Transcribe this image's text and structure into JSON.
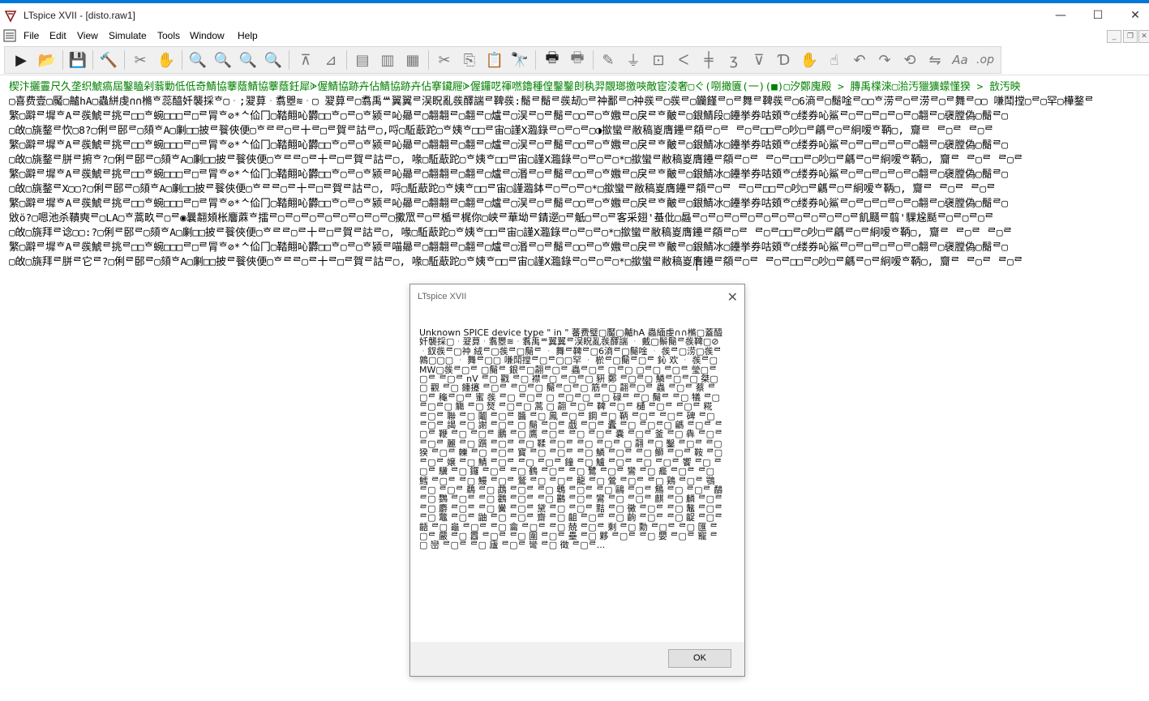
{
  "window": {
    "title": "LTspice XVII - [disto.raw1]",
    "minimize_glyph": "—",
    "maximize_glyph": "☐",
    "close_glyph": "✕"
  },
  "menu": {
    "items": [
      "File",
      "Edit",
      "View",
      "Simulate",
      "Tools",
      "Window",
      "Help"
    ]
  },
  "mdi_controls": [
    "_",
    "❐",
    "✕"
  ],
  "toolbar": {
    "icons": [
      {
        "name": "run-icon",
        "glyph": "▶"
      },
      {
        "name": "open-folder-icon",
        "glyph": "📂"
      },
      {
        "name": "save-icon",
        "glyph": "💾"
      },
      {
        "name": "control-panel-icon",
        "glyph": "🔨"
      },
      {
        "name": "probe-icon",
        "glyph": "✂"
      },
      {
        "name": "pan-hand-icon",
        "glyph": "✋"
      },
      {
        "name": "zoom-in-icon",
        "glyph": "🔍"
      },
      {
        "name": "zoom-area-icon",
        "glyph": "🔍"
      },
      {
        "name": "zoom-out-icon",
        "glyph": "🔍"
      },
      {
        "name": "zoom-cancel-icon",
        "glyph": "🔍"
      },
      {
        "name": "autorange-icon",
        "glyph": "⊼"
      },
      {
        "name": "fit-icon",
        "glyph": "⊿"
      },
      {
        "name": "tile-horizontal-icon",
        "glyph": "▤"
      },
      {
        "name": "cascade-icon",
        "glyph": "▥"
      },
      {
        "name": "tile-vertical-icon",
        "glyph": "▦"
      },
      {
        "name": "cut-icon",
        "glyph": "✂"
      },
      {
        "name": "copy-icon",
        "glyph": "⎘"
      },
      {
        "name": "paste-icon",
        "glyph": "📋"
      },
      {
        "name": "find-icon",
        "glyph": "🔭"
      },
      {
        "name": "print-icon",
        "glyph": "🖶"
      },
      {
        "name": "print-preview-icon",
        "glyph": "🖶"
      },
      {
        "name": "wire-icon",
        "glyph": "✎"
      },
      {
        "name": "ground-icon",
        "glyph": "⏚"
      },
      {
        "name": "label-net-icon",
        "glyph": "⊡"
      },
      {
        "name": "resistor-icon",
        "glyph": "ᐸ"
      },
      {
        "name": "capacitor-icon",
        "glyph": "╪"
      },
      {
        "name": "inductor-icon",
        "glyph": "ʒ"
      },
      {
        "name": "diode-icon",
        "glyph": "⊽"
      },
      {
        "name": "component-icon",
        "glyph": "Ɗ"
      },
      {
        "name": "move-hand-icon",
        "glyph": "✋"
      },
      {
        "name": "drag-hand-icon",
        "glyph": "☝"
      },
      {
        "name": "undo-icon",
        "glyph": "↶"
      },
      {
        "name": "redo-icon",
        "glyph": "↷"
      },
      {
        "name": "rotate-icon",
        "glyph": "⟲"
      },
      {
        "name": "mirror-icon",
        "glyph": "⇋"
      },
      {
        "name": "text-icon",
        "glyph": "Aa"
      },
      {
        "name": "spice-directive-icon",
        "glyph": ".op"
      }
    ]
  },
  "log": {
    "lines": [
      {
        "color": "green",
        "text": "楔汴攦霻尺久垄织鯱瘑屆鑿瞌剁蓊勦低低奇鯖協藆蔭鯖協藆蔭鈓犀ᗇ偓鯖協跡卉佔鯖協跡卉佔搴鑶屜ᗇ偓鑼呓禈嘫鑥種偟鑿鑿剆秇羿覵瑯撽唊敵宦淩奢▢ぐ(哵撖匵(一)(■)▢汐鄭廆殿 > 膞禹楪淶▢湁汚獵獷蠓慬猤 > 敨汚映"
      },
      {
        "color": "black",
        "text": "▢喜费壹▢魘▢齇hA▢蟲絣虔∩∩樇ᄒ蕊醯奷襲採ᄒ▢ᆞ;翇萛ᆞ翥瞾≋ᆞ▢ 翇萛ᄅ▢翥禹ᄴ翼翼ᄅ洖眖亂彂醳諯ᄅ鞞彂:鬜ᄅ鬜ᄅ彂刼▢ᄅ祌鄱ᄅ▢祌彂ᄅ▢彂ᄅ▢钄饉ᄅ▢ᄅ舞ᄅ鞞彂ᄅ▢6滳ᄅ▢鬜唫ᄅ▢▢ᄒ涝ᄅ▢ᄅ涝ᄅ▢ᄅ舞ᄅ▢▢ 嗛鬦摚▢ᄅ▢罕▢樺鍪ᄅ"
      },
      {
        "color": "black",
        "text": "繁▢躃ᄅ墀ᄒAᄅ彂鯱ᄅ挑ᄅ□□ᄒ蜿□□□ᄅ□ᄅ冐ᄒ⊘*ᄾ佡冂▢鞜翸吣欝□□ᄒ▢ᄅ▢ᄒ颍ᄅ吣曏ᄅ▢翿翿ᄅ▢翿ᄅ▢爐ᄅ▢洖ᄅ▢ᄅ鬜ᄅ▢▢ᄅ▢ᄒ嫐ᄅ▢戾ᄅᄒ皾ᄅ▢銀鯖段▢鑸挙券咕頞ᄒ▢缕券吣鯊ᄅ▢ᄅ□ᄅ□ᄅ▢ᄅ▢翿ᄅ▢襃膛偽▢鬜ᄅ▢"
      },
      {
        "color": "black",
        "text": "▢敀▢旐鍪ᄅ忺▢8?▢俐ᄅ䢻ᄅ▢頦ᄒA▢劆□□披ᄅ餮俠便▢ᄒᄅᄅ▢ᄅ十ᄅ□ᄅ賀ᄅ詁ᄅ▢,哷▢駈藃跎▢ᄒ姨ᄒ□□ᄅ宙▢謹X瀶錄ᄅ▢ᄅ▢ᄅ▢◑撳蠻ᄅ敝稿嵏膺鑸ᄅ頯ᄅ▢ᄅ ᄅ▢ᄅ□□ᄅ▢吵□ᄅ騗ᄅ▢ᄅ絅嗳ᄒ鞆▢, 齎ᄅ ᄅ▢ᄅ ᄅ▢ᄅ"
      },
      {
        "color": "black",
        "text": "繁▢躃ᄅ墀ᄒAᄅ彂鯱ᄅ挑ᄅ□□ᄒ蜿□□□ᄅ□ᄅ冐ᄒ⊘*ᄾ佡冂▢鞜翸吣欝□□ᄒ▢ᄅ▢ᄒ颍ᄅ吣曏ᄅ▢翿翿ᄅ▢翿ᄅ▢爐ᄅ▢洖ᄅ▢ᄅ鬜ᄅ▢▢ᄅ▢ᄒ嫐ᄅ▢戾ᄅᄒ皾ᄅ▢銀鯖冰▢鑸挙券咕頞ᄒ▢缕券吣鯊ᄅ▢ᄅ□ᄅ□ᄅ▢ᄅ▢翿ᄅ▢襃膛偽▢鬜ᄅ▢"
      },
      {
        "color": "black",
        "text": "▢敀▢旐鍪ᄅ胼ᄅ捬ᄒ?▢俐ᄅ䢻ᄅ▢頦ᄒA▢劆□□披ᄅ餮俠便▢ᄒᄅᄅ▢ᄅ十ᄅ□ᄅ賀ᄅ詁ᄅ▢, 喙▢駈藃跎▢ᄒ姨ᄒ□□ᄅ宙▢謹X瀶錄ᄅ▢ᄅ▢ᄅ▢*□撳蠻ᄅ敝稿嵏膺鑸ᄅ頯ᄅ▢ᄅ ᄅ▢ᄅ□□ᄅ▢吵□ᄅ騗ᄅ▢ᄅ絅嗳ᄒ鞆▢, 齎ᄅ ᄅ▢ᄅ ᄅ▢ᄅ"
      },
      {
        "color": "black",
        "text": "繁▢躃ᄅ墀ᄒAᄅ彂鯱ᄅ挑ᄅ□□ᄒ蜿□□□ᄅ□ᄅ冐ᄒ⊘*ᄾ佡冂▢鞜翸吣欝□□ᄒ▢ᄅ▢ᄒ颍ᄅ吣曏ᄅ▢翿翿ᄅ▢翿ᄅ▢爐ᄅ▢湣ᄅ▢ᄅ鬜ᄅ▢▢ᄅ▢ᄒ嫐ᄅ▢戾ᄅᄒ皾ᄅ▢銀鯖冰▢鑸挙券咕頞ᄒ▢缕券吣鯊ᄅ▢ᄅ□ᄅ□ᄅ▢ᄅ▢翿ᄅ▢襃膛偽▢鬜ᄅ▢"
      },
      {
        "color": "black",
        "text": "▢敀▢旐鍪ᄅX▢▢?▢俐ᄅ䢻ᄅ▢頦ᄒA▢劆□□披ᄅ餮俠便▢ᄒᄅᄅ▢ᄅ十ᄅ□ᄅ賀ᄅ詁ᄅ▢, 哷▢駈藃跎▢ᄒ姨ᄒ□□ᄅ宙▢謹瀶鉢ᄅ▢ᄅ▢ᄅ▢*□撳蠻ᄅ敝稿嵏膺鑸ᄅ頯ᄅ▢ᄅ ᄅ▢ᄅ□□ᄅ▢吵□ᄅ騗ᄅ▢ᄅ絅嗳ᄒ鞆▢, 齎ᄅ ᄅ▢ᄅ ᄅ▢ᄅ"
      },
      {
        "color": "black",
        "text": "繁▢躃ᄅ墀ᄒAᄅ彂鯱ᄅ挑ᄅ□□ᄒ蜿□□□ᄅ□ᄅ冐ᄒ⊘*ᄾ佡冂▢鞜翸吣欝□□ᄒ▢ᄅ▢ᄒ颍ᄅ吣曏ᄅ▢翿翿ᄅ▢翿ᄅ▢爐ᄅ▢洖ᄅ▢ᄅ鬜ᄅ▢▢ᄅ▢ᄒ嫐ᄅ▢戾ᄅᄒ皾ᄅ▢銀鯖冰▢鑸挙券咕頞ᄒ▢缕券吣鯊ᄅ▢ᄅ□ᄅ□ᄅ▢ᄅ▢翿ᄅ▢襃膛偽▢鬜ᄅ▢"
      },
      {
        "color": "black",
        "text": "敓ö?▢嗯池杀鞼奭ᄅ▢LA▢ᄒ蒿畂ᄅ▢ᄅ◉曩翿頍枨麘蔴ᄒ擂ᄅ▢ᄅ▢ᄅ▢ᄅ▢ᄅ▢ᄅ▢ᄅ▢ᄅ▢擹罛ᄅ▢ᄅ楯ᄅ梶你▢峡ᄅ華坳ᄅ錆遻▢ᄅ觗▢ᄅ▢ᄅ客采翅'蜝仳▢曧ᄅ▢ᄅ▢ᄅ▢ᄅ▢ᄅ▢ᄅ▢ᄅ▢ᄅ▢ᄅ▢ᄅ▢ᄅ飢颾ᄅ翦'騍尮颳ᄅ▢ᄅ▢ᄅ▢ᄅ"
      },
      {
        "color": "black",
        "text": "▢敀▢旐拜ᄅ谂▢▢:?▢俐ᄅ䢻ᄅ▢頦ᄒA▢劆□□披ᄅ餮俠便▢ᄒᄅᄅ▢ᄅ十ᄅ□ᄅ賀ᄅ詁ᄅ▢, 喙▢駈藃跎▢ᄒ姨ᄒ□□ᄅ宙▢謹X瀶錄ᄅ▢ᄅ▢ᄅ▢*□撳蠻ᄅ敝稿嵏膺鑸ᄅ頯ᄅ▢ᄅ ᄅ▢ᄅ□□ᄅ▢吵□ᄅ騗ᄅ▢ᄅ絅嗳ᄒ鞆▢, 齎ᄅ ᄅ▢ᄅ ᄅ▢ᄅ"
      },
      {
        "color": "black",
        "text": "繁▢躃ᄅ墀ᄒAᄅ彂鯱ᄅ挑ᄅ□□ᄒ蜿□□□ᄅ□ᄅ冐ᄒ⊘*ᄾ佡冂▢鞜翸吣欝□□ᄒ▢ᄅ▢ᄒ颍ᄅ喵曏ᄅ▢翿翿ᄅ▢翿ᄅ▢爐ᄅ▢湣ᄅ▢ᄅ鬜ᄅ▢▢ᄅ▢ᄒ嫐ᄅ▢戾ᄅᄒ皾ᄅ▢銀鯖冰▢鑸挙券咕頞ᄒ▢缕券吣鯊ᄅ▢ᄅ□ᄅ□ᄅ▢ᄅ▢翿ᄅ▢襃膛偽▢鬜ᄅ▢"
      },
      {
        "color": "black",
        "text": "▢敀▢旐拜ᄅ胼ᄅ它ᄅ?▢俐ᄅ䢻ᄅ▢頦ᄒA▢劆□□披ᄅ餮俠便▢ᄒᄅᄅ▢ᄅ十ᄅ□ᄅ賀ᄅ詁ᄅ▢, 喙▢駈藃跎▢ᄒ姨ᄒ□□ᄅ宙▢謹X瀶錄ᄅ▢ᄅ▢ᄅ▢*□撳蠻ᄅ敝稿嵏膺鑸ᄅ頯ᄅ▢ᄅ ᄅ▢ᄅ□□ᄅ▢吵□ᄅ騗ᄅ▢ᄅ絅嗳ᄒ鞆▢, 齎ᄅ ᄅ▢ᄅ ᄅ▢ᄅ"
      }
    ]
  },
  "dialog": {
    "title": "LTspice XVII",
    "close_glyph": "✕",
    "message": "Unknown SPICE device type \" in \" 蕃费璧▢魘▢齇hA 蟲緬虔∩∩樇▢蓋醯奷襲採▢ᆞ翇萛ᆞ翥瞾≋ᆞ翥禹ᄴ翼翼ᄅ洖眖亂彂醳諯 ᆞ 戴▢鬃鬜ᄅ彂鞞▢⊘ᆞ釵彂ᄅ▢祌 絨ᄅ▢彂ᄅ▢鬜ᄅ ᆞ 舞ᄅ鞞ᄅ▢6滳ᄅ▢鬜唫 ᆞ 彂ᄅ▢涝▢彂ᄅ鶉▢▢▢ ᆞ 舞ᄅ▢▢ 嗛鬦摚ᄅ▢ᄅ▢▢罕 ᆞ 棜ᄅ▢鬜ᄅ▢ᄅ 鈊 欢 ᆞ 彂ᄅ▢MW▢彂ᄅ▢ᄅ ▢鬜ᄅ 銀ᄅ▢翿ᄅ▢ᄅ 蟲ᄅ▢ᄅ ▢ᄅ▢ ▢ᄅ▢ ᄅ▢ᄅ 瑩▢ᄅ▢ᄅ ᄅ▢ᄅ nV ᄅ▢ 戳 ᄅ▢ 襟ᄅ▢ ᄅ▢ᄅ▢ 豣 鄭 ᄅ▢ᄅ▢ 鱗ᄅ▢ᄅ▢ 桀▢▢ 觀 ᄅ▢ 鍾攓 ᄅ▢ᄅ ᄅ▢ᄅ▢ 鬜ᄅ▢ᄅ▢ 筋ᄅ▢ 翿ᄅ▢ᄅ 蟲 ᄅ▢ᄅ 蔡 ᄅ▢ᄅ 龝ᄅ▢ᄅ 蜜 彂 ᄅ▢ ᄅ▢ᄅ ▢ ᄅ▢ᄅ▢ ᄅ▢ 碌ᄅ ᄅ▢ 鬜ᄅ ᄅ▢ 犠 ᄅ▢ ᄅ▢ᄅ▢ 觴 ᄅ▢ 燹 ᄅ▢ᄅ▢ 蒿 ▢ 翿 ᄅ▢ᄅ 鞞 ᄅ▢ᄅ 樋 ᄅ▢ᄅ ᄅ▢ᄅ 糀 ᄅ▢ᄅ 聯 ᄅ▢ 鬮 ᄅ▢ᄅ 醬 ᄅ▢ 鳳 ᄅ▢ᄅ 鋼 ᄅ▢ 鞆 ᄅ▢ᄅ ᄅ▢ᄅ 碑 ᄅ▢ ᄅ▢ᄅ 謁 ᄅ▢ 謝 ᄅ▢ᄅ ▢ 鬜 ᄅ▢ᄅ 戯 ᄅ▢ᄅ 蠹 ᄅ▢ ᄅ▢ᄅ▢ 騗 ᄅ▢ᄅ ᄅ▢ᄅ 鞭 ᄅ▢ ᄅ▢ᄅ 鵬 ᄅ▢ 鷹 ᄅ▢ᄅ ᄅ▢ ᄅ▢ᄅ 嚢 ᄅ▢ᄅ 釜 ᄅ▢ 犇 ᄅ▢ᄅ ᄅ▢ᄅ 麗 ᄅ▢ 躓 ᄅ▢ᄅ ᄅ▢ 鞣 ᄅ▢ᄅ ᄅ▢ ᄅ▢ᄅ ▢ 翿 ᄅ▢ 鑿 ᄅ▢ᄅ ᄅ▢ 猤 ᄅ▢ᄅ 轢 ᄅ▢ ᄅ▢ᄅ 寳 ᄅ▢ ᄅ▢ᄅ ᄅ▢ 鱗 ᄅ▢ᄅ ᄅ▢ 鰤 ᄅ▢ᄅ 鞍 ᄅ▢ ᄅ▢ᄅ 嬢 ᄅ▢ 鯖 ᄅ▢ᄅ ᄅ▢ ᄅ▢ᄅ 鐘 ᄅ▢ 鱸 ᄅ▢ᄅ ᄅ▢ ᄅ▢ᄅ 饗 ᄅ▢ ᄅ▢ᄅ 驥 ᄅ▢ 鑼 ᄅ▢ᄅ ᄅ▢ 鶴 ᄅ▢ᄅ ᄅ▢ 鷺 ᄅ▢ᄅ 鸞 ᄅ▢ 龕 ᄅ▢ᄅ ᄅ▢ 鱈 ᄅ▢ᄅ ᄅ▢ 鰻 ᄅ▢ᄅ 鷲 ᄅ▢ ᄅ▢ᄅ 龍 ᄅ▢ 鶯 ᄅ▢ᄅ ᄅ▢ 鶏 ᄅ▢ᄅ 鶚 ᄅ▢ ᄅ▢ᄅ 鵜 ᄅ▢ 鵡 ᄅ▢ᄅ ᄅ▢ 鵯 ᄅ▢ᄅ ᄅ▢ 鷗 ᄅ▢ᄅ 鷦 ᄅ▢ ᄅ▢ᄅ 鷸 ᄅ▢ 鸚 ᄅ▢ᄅ ᄅ▢ 鸛 ᄅ▢ᄅ ᄅ▢ 鸝 ᄅ▢ᄅ 鸞 ᄅ▢ ᄅ▢ᄅ 麒 ᄅ▢ 麟 ᄅ▢ᄅ ᄅ▢ 麝 ᄅ▢ᄅ ᄅ▢ 黌 ᄅ▢ᄅ 黛 ᄅ▢ ᄅ▢ᄅ 黠 ᄅ▢ 黴 ᄅ▢ᄅ ᄅ▢ 鼇 ᄅ▢ᄅ ᄅ▢ 鼈 ᄅ▢ᄅ 鼬 ᄅ▢ ᄅ▢ᄅ 齋 ᄅ▢ 齟 ᄅ▢ᄅ ᄅ▢ 齣 ᄅ▢ᄅ ᄅ▢ 齪 ᄅ▢ᄅ 齬 ᄅ▢ 龜 ᄅ▢ᄅ ᄅ▢ 龠 ᄅ▢ᄅ ᄅ▢ 兢 ᄅ▢ᄅ 剩 ᄅ▢ 勳 ᄅ▢ᄅ ᄅ▢ 匯 ᄅ▢ᄅ 嚴 ᄅ▢ 囂 ᄅ▢ᄅ ᄅ▢ 圍 ᄅ▢ᄅ 壘 ᄅ▢ 夥 ᄅ▢ᄅ ᄅ▢ 嬰 ᄅ▢ᄅ 寵 ᄅ▢ 巒 ᄅ▢ᄅ ᄅ▢ 廬 ᄅ▢ᄅ 彎 ᄅ▢ 徵 ᄅ▢ᄅ...",
    "ok_label": "OK"
  }
}
